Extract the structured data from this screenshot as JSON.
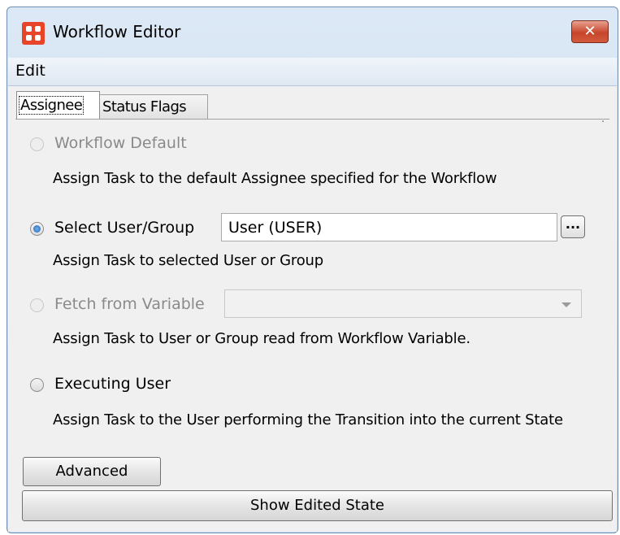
{
  "window": {
    "title": "Workflow Editor",
    "close_symbol": "✕",
    "icons": {
      "app": "app-logo-icon",
      "close": "close-icon"
    }
  },
  "menubar": {
    "items": [
      {
        "label": "Edit"
      }
    ]
  },
  "tabs": [
    {
      "label": "Assignee",
      "selected": true
    },
    {
      "label": "Status Flags",
      "selected": false
    }
  ],
  "options": [
    {
      "label": "Workflow Default",
      "enabled": false,
      "checked": false,
      "description": "Assign Task to the default Assignee specified for the Workflow"
    },
    {
      "label": "Select User/Group",
      "enabled": true,
      "checked": true,
      "description": "Assign Task to selected User or Group",
      "field_value": "User (USER)",
      "browse_label": "..."
    },
    {
      "label": "Fetch from Variable",
      "enabled": false,
      "checked": false,
      "description": "Assign Task to User or Group read from Workflow Variable.",
      "dropdown_value": ""
    },
    {
      "label": "Executing User",
      "enabled": true,
      "checked": false,
      "description": "Assign Task to the User performing the Transition into the current State"
    }
  ],
  "buttons": {
    "advanced": "Advanced",
    "show_edited_state": "Show Edited State"
  },
  "colors": {
    "titlebar": "#c7d9ee",
    "close_button": "#c7452b",
    "app_icon": "#e8442a",
    "radio_selected": "#1f62b0"
  }
}
